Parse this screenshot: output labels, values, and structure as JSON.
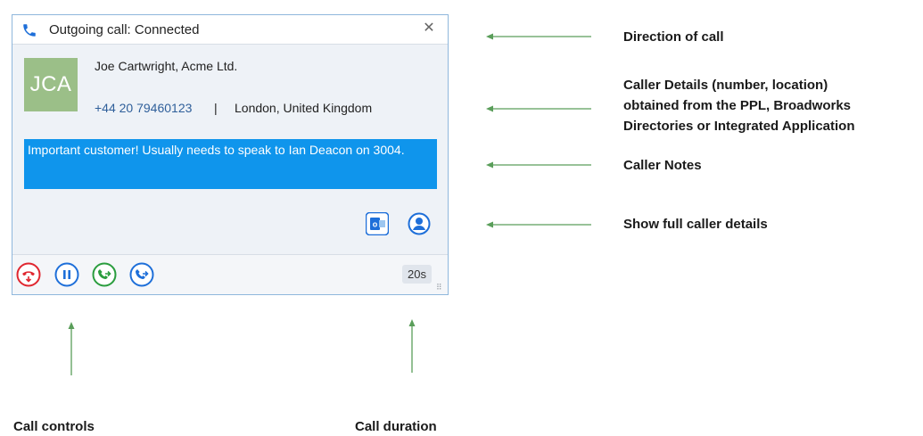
{
  "popup": {
    "title": "Outgoing call: Connected",
    "close_icon": "close-icon",
    "avatar_initials": "JCA",
    "caller_name": "Joe Cartwright, Acme Ltd.",
    "caller_number": "+44 20 79460123",
    "separator": "|",
    "caller_location": "London, United Kingdom",
    "notes": "Important customer! Usually needs to speak to Ian Deacon on 3004.",
    "duration": "20s",
    "colors": {
      "accent_blue": "#0f95ec",
      "avatar_green": "#9bbf88",
      "end_call_red": "#e0262f",
      "transfer_green": "#2a9d3e",
      "hold_blue": "#1e6fd9"
    }
  },
  "annotations": {
    "direction": "Direction of call",
    "caller_details_1": "Caller Details (number, location)",
    "caller_details_2": "obtained from the PPL, Broadworks",
    "caller_details_3": "Directories or Integrated Application",
    "caller_notes": "Caller Notes",
    "full_details": "Show full caller details",
    "call_controls": "Call controls",
    "call_duration": "Call duration"
  }
}
